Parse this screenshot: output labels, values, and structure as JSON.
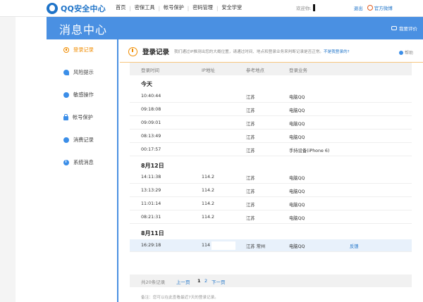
{
  "topbar": {
    "logo_text": "QQ安全中心",
    "nav": [
      "首页",
      "密保工具",
      "帐号保护",
      "密码管理",
      "安全学堂"
    ],
    "welcome": "欢迎你:",
    "logout": "退出",
    "weibo": "官方微博"
  },
  "header": {
    "title": "消息中心",
    "feedback": "我要评价"
  },
  "sidebar": {
    "items": [
      {
        "label": "登录记录",
        "icon": "clock-icon"
      },
      {
        "label": "风险提示",
        "icon": "bird-icon"
      },
      {
        "label": "敏感操作",
        "icon": "face-icon"
      },
      {
        "label": "帐号保护",
        "icon": "lock-icon"
      },
      {
        "label": "消费记录",
        "icon": "coin-icon"
      },
      {
        "label": "系统消息",
        "icon": "info-icon"
      }
    ]
  },
  "main": {
    "title": "登录记录",
    "desc": "我们通过IP推测出您的大概位置，请通过时间、地点和登录业务来判断记录是否正常。",
    "desc_link": "不是我登录的?",
    "help": "帮助",
    "columns": [
      "登录时间",
      "IP地址",
      "参考地点",
      "登录业务"
    ],
    "sections": [
      {
        "label": "今天",
        "rows": [
          {
            "time": "10:40:44",
            "ip": "",
            "loc": "江苏",
            "biz": "电脑QQ",
            "action": ""
          },
          {
            "time": "09:18:08",
            "ip": "",
            "loc": "江苏",
            "biz": "电脑QQ",
            "action": ""
          },
          {
            "time": "09:09:01",
            "ip": "",
            "loc": "江苏",
            "biz": "电脑QQ",
            "action": ""
          },
          {
            "time": "08:13:49",
            "ip": "",
            "loc": "江苏",
            "biz": "电脑QQ",
            "action": ""
          },
          {
            "time": "00:17:57",
            "ip": "",
            "loc": "江苏",
            "biz": "手持设备(iPhone 6)",
            "action": ""
          }
        ]
      },
      {
        "label": "8月12日",
        "rows": [
          {
            "time": "14:11:38",
            "ip": "114.2",
            "loc": "江苏",
            "biz": "电脑QQ",
            "action": ""
          },
          {
            "time": "13:13:29",
            "ip": "114.2",
            "loc": "江苏",
            "biz": "电脑QQ",
            "action": ""
          },
          {
            "time": "11:01:14",
            "ip": "114.2",
            "loc": "江苏",
            "biz": "电脑QQ",
            "action": ""
          },
          {
            "time": "08:21:31",
            "ip": "114.2",
            "loc": "江苏",
            "biz": "电脑QQ",
            "action": ""
          }
        ]
      },
      {
        "label": "8月11日",
        "rows": [
          {
            "time": "16:29:18",
            "ip": "114",
            "loc": "江苏 常州",
            "biz": "电脑QQ",
            "action": "反馈"
          }
        ]
      }
    ],
    "pager": {
      "total": "共20条记录",
      "prev": "上一页",
      "p1": "1",
      "p2": "2",
      "next": "下一页"
    },
    "note": "备注：您可以在此查看最近7天的登录记录。"
  },
  "colors": {
    "accent_blue": "#4a90e2",
    "accent_orange": "#f08c00",
    "link": "#1e73c8"
  }
}
